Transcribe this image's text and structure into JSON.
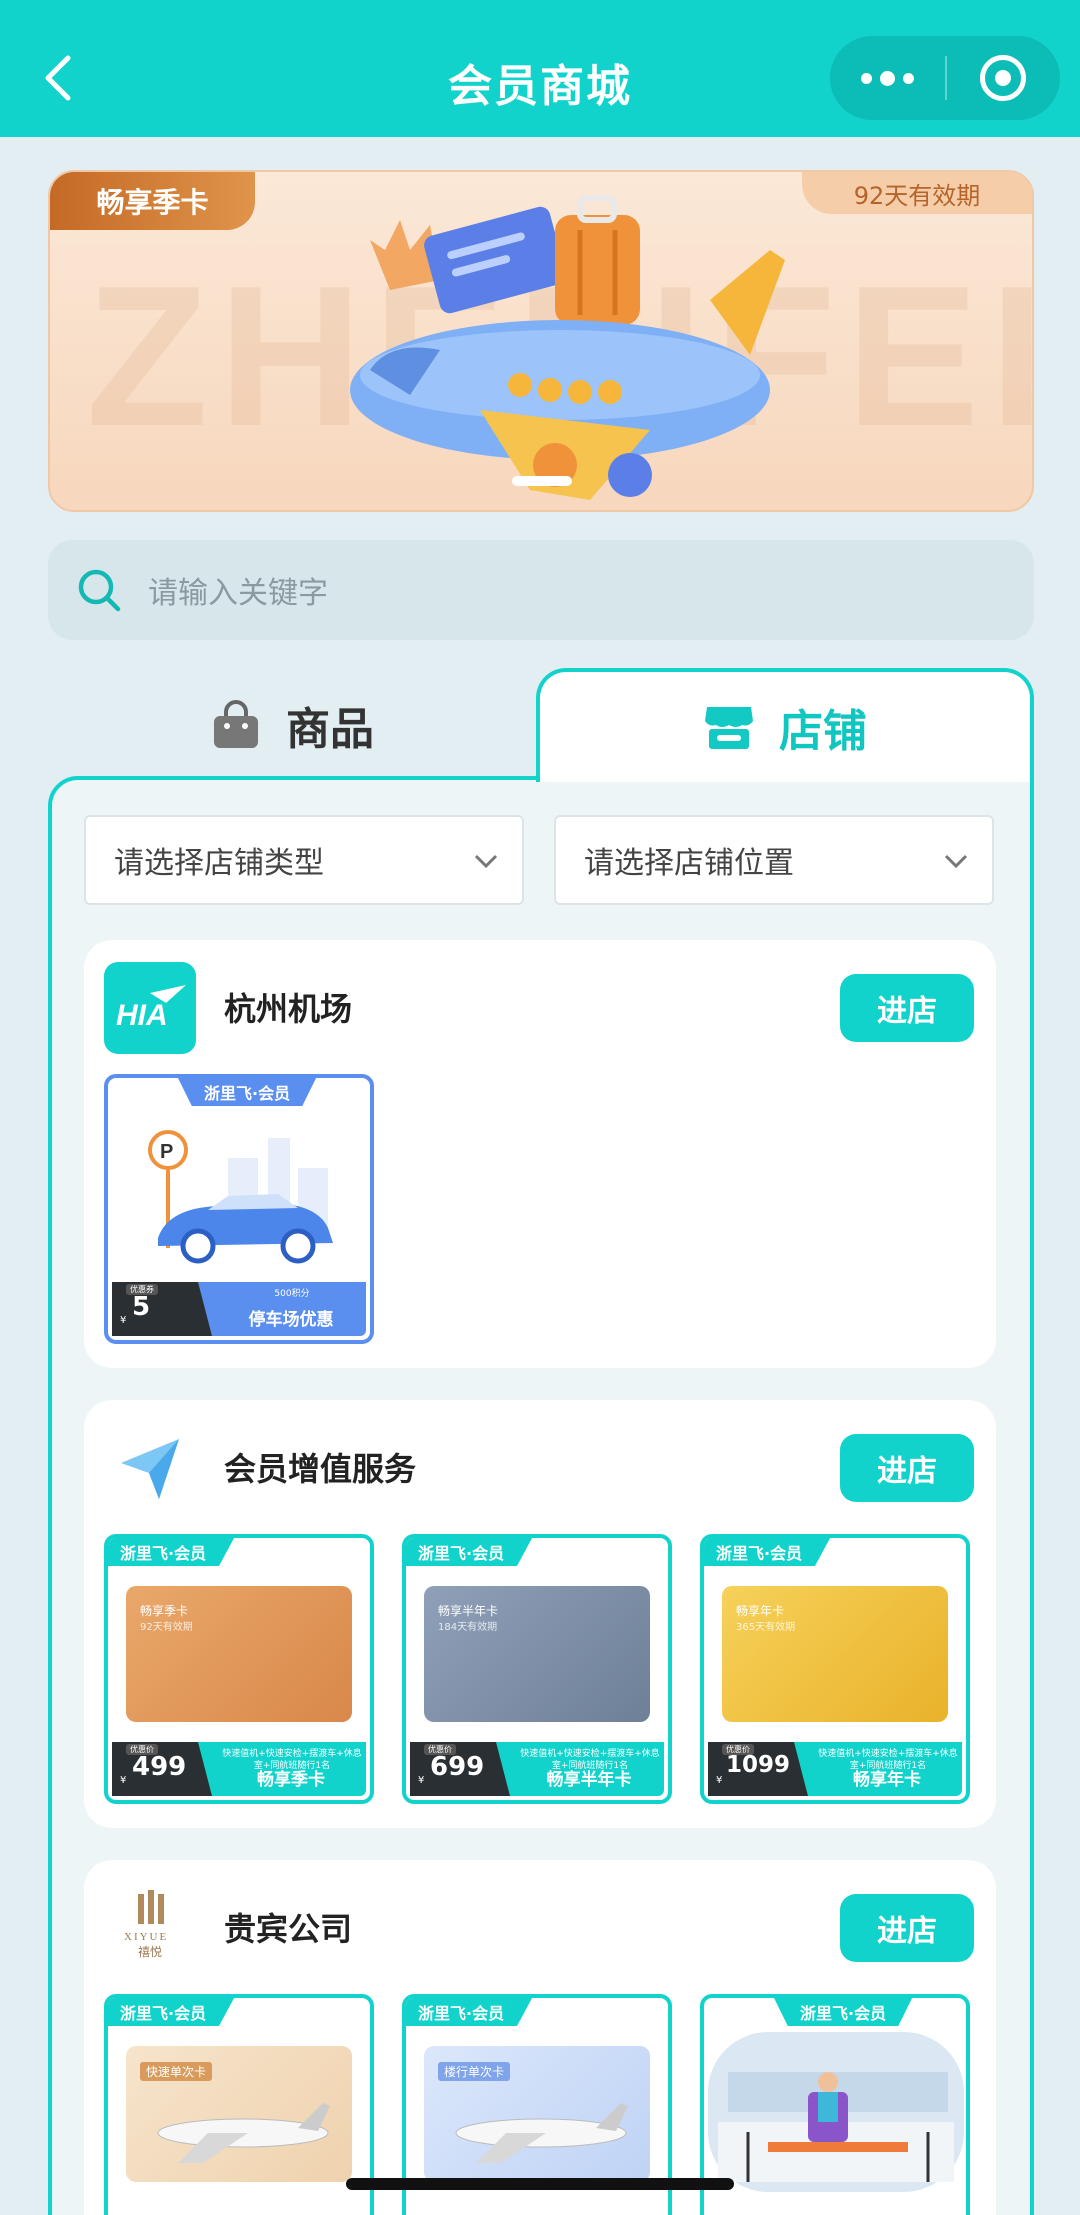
{
  "header": {
    "title": "会员商城",
    "back_icon": "chevron-left-icon",
    "more_icon": "more-dots-icon",
    "close_icon": "target-icon"
  },
  "banner": {
    "tag": "畅享季卡",
    "validity": "92天有效期",
    "watermark": "ZHELIFEI"
  },
  "search": {
    "placeholder": "请输入关键字"
  },
  "tabs": [
    {
      "label": "商品",
      "icon": "shopping-bag-icon",
      "active": false
    },
    {
      "label": "店铺",
      "icon": "store-icon",
      "active": true
    }
  ],
  "filters": {
    "type_placeholder": "请选择店铺类型",
    "location_placeholder": "请选择店铺位置"
  },
  "stores": [
    {
      "name": "杭州机场",
      "logo_text": "HIA",
      "enter_label": "进店",
      "products": [
        {
          "ribbon": "浙里飞·会员",
          "price": "5",
          "price_tag": "优惠券",
          "subtitle": "500积分",
          "name": "停车场优惠",
          "sign": "P"
        }
      ]
    },
    {
      "name": "会员增值服务",
      "enter_label": "进店",
      "products": [
        {
          "ribbon": "浙里飞·会员",
          "card_title": "畅享季卡",
          "card_sub": "92天有效期",
          "price": "499",
          "price_tag": "优惠价",
          "features": "快速值机+快速安检+摆渡车+休息室+同航班随行1名",
          "name": "畅享季卡",
          "color": "#e19a5c"
        },
        {
          "ribbon": "浙里飞·会员",
          "card_title": "畅享半年卡",
          "card_sub": "184天有效期",
          "price": "699",
          "price_tag": "优惠价",
          "features": "快速值机+快速安检+摆渡车+休息室+同航班随行1名",
          "name": "畅享半年卡",
          "color": "#7d8fa8"
        },
        {
          "ribbon": "浙里飞·会员",
          "card_title": "畅享年卡",
          "card_sub": "365天有效期",
          "price": "1099",
          "price_tag": "优惠价",
          "features": "快速值机+快速安检+摆渡车+休息室+同航班随行1名",
          "name": "畅享年卡",
          "color": "#efc13a"
        }
      ]
    },
    {
      "name": "贵宾公司",
      "logo_text": "XIYUE",
      "logo_cn": "禧悦",
      "enter_label": "进店",
      "products": [
        {
          "ribbon": "浙里飞·会员",
          "card_title": "快速单次卡"
        },
        {
          "ribbon": "浙里飞·会员",
          "card_title": "楼行单次卡"
        },
        {
          "ribbon": "浙里飞·会员"
        }
      ]
    }
  ]
}
